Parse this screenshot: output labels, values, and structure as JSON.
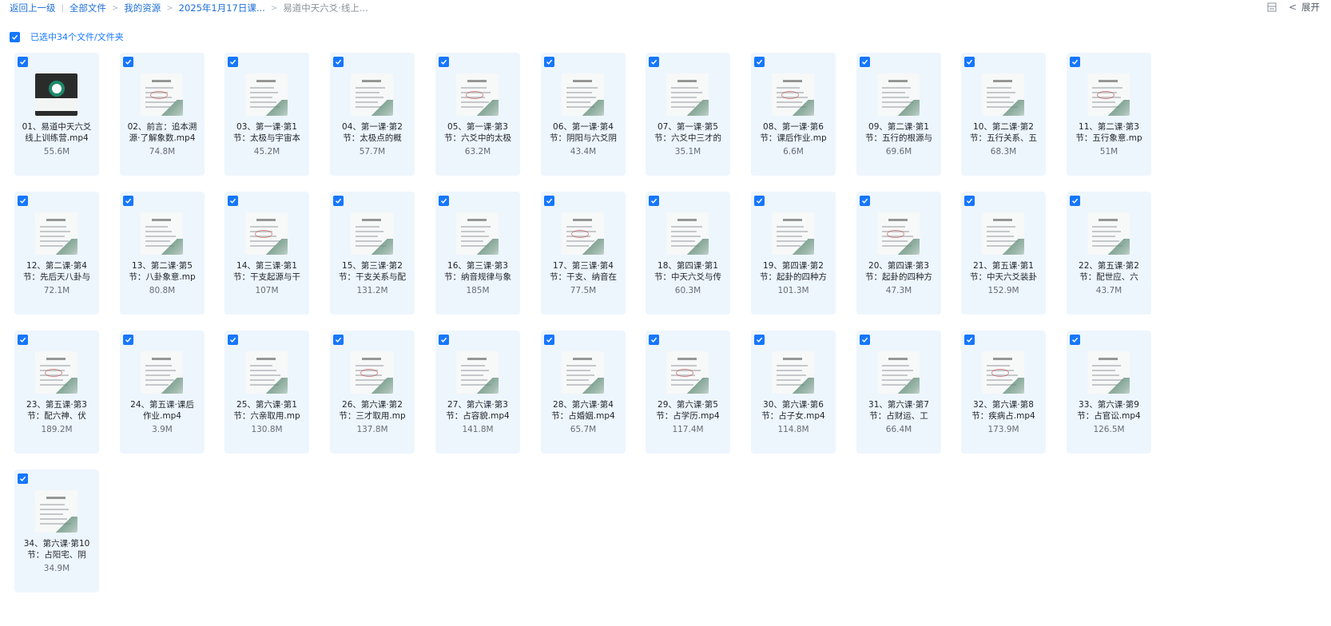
{
  "breadcrumb": {
    "back": "返回上一级",
    "items": [
      "全部文件",
      "我的资源",
      "2025年1月17日课...",
      "易道中天六爻·线上..."
    ]
  },
  "toolbar": {
    "expand": "展开"
  },
  "selection": {
    "label": "已选中34个文件/文件夹",
    "checked": true
  },
  "colors": {
    "accent": "#1677ff",
    "card_bg": "#eef6fd",
    "link": "#1e6fd9"
  },
  "files": [
    {
      "line1": "01、易道中天六爻",
      "line2": "线上训练营.mp4",
      "size": "55.6M",
      "logo": true
    },
    {
      "line1": "02、前言：追本溯",
      "line2": "源·了解象数.mp4",
      "size": "74.8M"
    },
    {
      "line1": "03、第一课·第1",
      "line2": "节：太极与宇宙本",
      "size": "45.2M"
    },
    {
      "line1": "04、第一课·第2",
      "line2": "节：太极点的概",
      "size": "57.7M"
    },
    {
      "line1": "05、第一课·第3",
      "line2": "节：六爻中的太极",
      "size": "63.2M"
    },
    {
      "line1": "06、第一课·第4",
      "line2": "节：阴阳与六爻阴",
      "size": "43.4M"
    },
    {
      "line1": "07、第一课·第5",
      "line2": "节：六爻中三才的",
      "size": "35.1M"
    },
    {
      "line1": "08、第一课·第6",
      "line2": "节：课后作业.mp",
      "size": "6.6M"
    },
    {
      "line1": "09、第二课·第1",
      "line2": "节：五行的根源与",
      "size": "69.6M"
    },
    {
      "line1": "10、第二课·第2",
      "line2": "节：五行关系、五",
      "size": "68.3M"
    },
    {
      "line1": "11、第二课·第3",
      "line2": "节：五行象意.mp",
      "size": "51M"
    },
    {
      "line1": "12、第二课·第4",
      "line2": "节：先后天八卦与",
      "size": "72.1M"
    },
    {
      "line1": "13、第二课·第5",
      "line2": "节：八卦象意.mp",
      "size": "80.8M"
    },
    {
      "line1": "14、第三课·第1",
      "line2": "节：干支起源与干",
      "size": "107M"
    },
    {
      "line1": "15、第三课·第2",
      "line2": "节：干支关系与配",
      "size": "131.2M"
    },
    {
      "line1": "16、第三课·第3",
      "line2": "节：纳音规律与象",
      "size": "185M"
    },
    {
      "line1": "17、第三课·第4",
      "line2": "节：干支、纳音在",
      "size": "77.5M"
    },
    {
      "line1": "18、第四课·第1",
      "line2": "节：中天六爻与传",
      "size": "60.3M"
    },
    {
      "line1": "19、第四课·第2",
      "line2": "节：起卦的四种方",
      "size": "101.3M"
    },
    {
      "line1": "20、第四课·第3",
      "line2": "节：起卦的四种方",
      "size": "47.3M"
    },
    {
      "line1": "21、第五课·第1",
      "line2": "节：中天六爻装卦",
      "size": "152.9M"
    },
    {
      "line1": "22、第五课·第2",
      "line2": "节：配世应、六",
      "size": "43.7M"
    },
    {
      "line1": "23、第五课·第3",
      "line2": "节：配六神、伏",
      "size": "189.2M"
    },
    {
      "line1": "24、第五课·课后",
      "line2": "作业.mp4",
      "size": "3.9M"
    },
    {
      "line1": "25、第六课·第1",
      "line2": "节：六亲取用.mp",
      "size": "130.8M"
    },
    {
      "line1": "26、第六课·第2",
      "line2": "节：三才取用.mp",
      "size": "137.8M"
    },
    {
      "line1": "27、第六课·第3",
      "line2": "节：占容貌.mp4",
      "size": "141.8M"
    },
    {
      "line1": "28、第六课·第4",
      "line2": "节：占婚姻.mp4",
      "size": "65.7M"
    },
    {
      "line1": "29、第六课·第5",
      "line2": "节：占学历.mp4",
      "size": "117.4M"
    },
    {
      "line1": "30、第六课·第6",
      "line2": "节：占子女.mp4",
      "size": "114.8M"
    },
    {
      "line1": "31、第六课·第7",
      "line2": "节：占财运、工",
      "size": "66.4M"
    },
    {
      "line1": "32、第六课·第8",
      "line2": "节：疾病占.mp4",
      "size": "173.9M"
    },
    {
      "line1": "33、第六课·第9",
      "line2": "节：占官讼.mp4",
      "size": "126.5M"
    },
    {
      "line1": "34、第六课·第10",
      "line2": "节：占阳宅、阴",
      "size": "34.9M"
    }
  ]
}
